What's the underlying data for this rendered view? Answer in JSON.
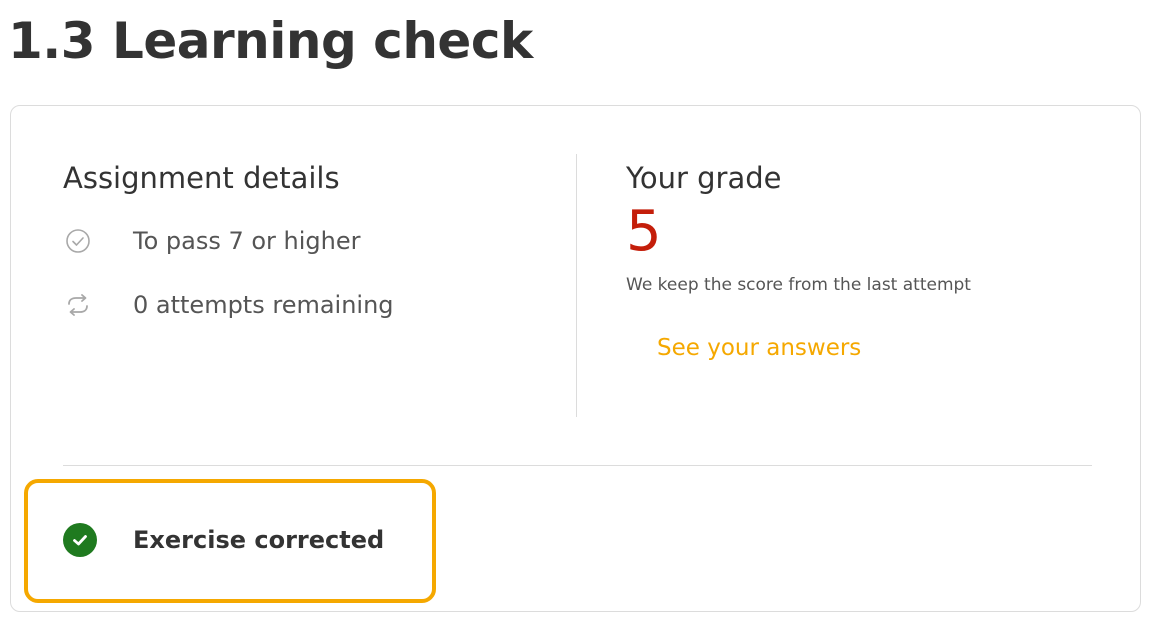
{
  "page": {
    "title": "1.3 Learning check"
  },
  "assignment": {
    "heading": "Assignment details",
    "items": [
      {
        "icon": "check-circle-outline-icon",
        "text": "To pass 7 or higher"
      },
      {
        "icon": "repeat-icon",
        "text": "0 attempts remaining"
      }
    ]
  },
  "grade": {
    "heading": "Your grade",
    "value": "5",
    "note": "We keep the score from the last attempt",
    "link_label": "See your answers"
  },
  "status": {
    "icon": "check-circle-filled-icon",
    "text": "Exercise corrected"
  },
  "colors": {
    "grade": "#c41e0a",
    "accent": "#f5a800",
    "success": "#1f7a1f"
  }
}
